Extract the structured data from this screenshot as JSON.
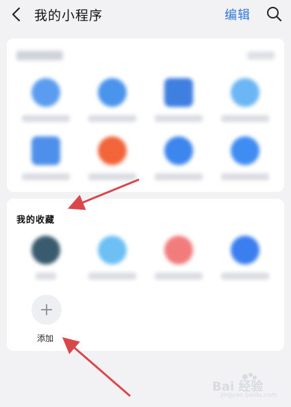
{
  "header": {
    "title": "我的小程序",
    "edit_label": "编辑"
  },
  "favorites": {
    "title": "我的收藏",
    "add_label": "添加"
  },
  "watermark": {
    "brand": "Bai 经验",
    "url": "jingyan.baidu.com"
  },
  "colors": {
    "accent": "#2f78d4",
    "annotation_arrow": "#d9474b"
  },
  "icons": [
    "back-icon",
    "search-icon",
    "plus-icon"
  ]
}
